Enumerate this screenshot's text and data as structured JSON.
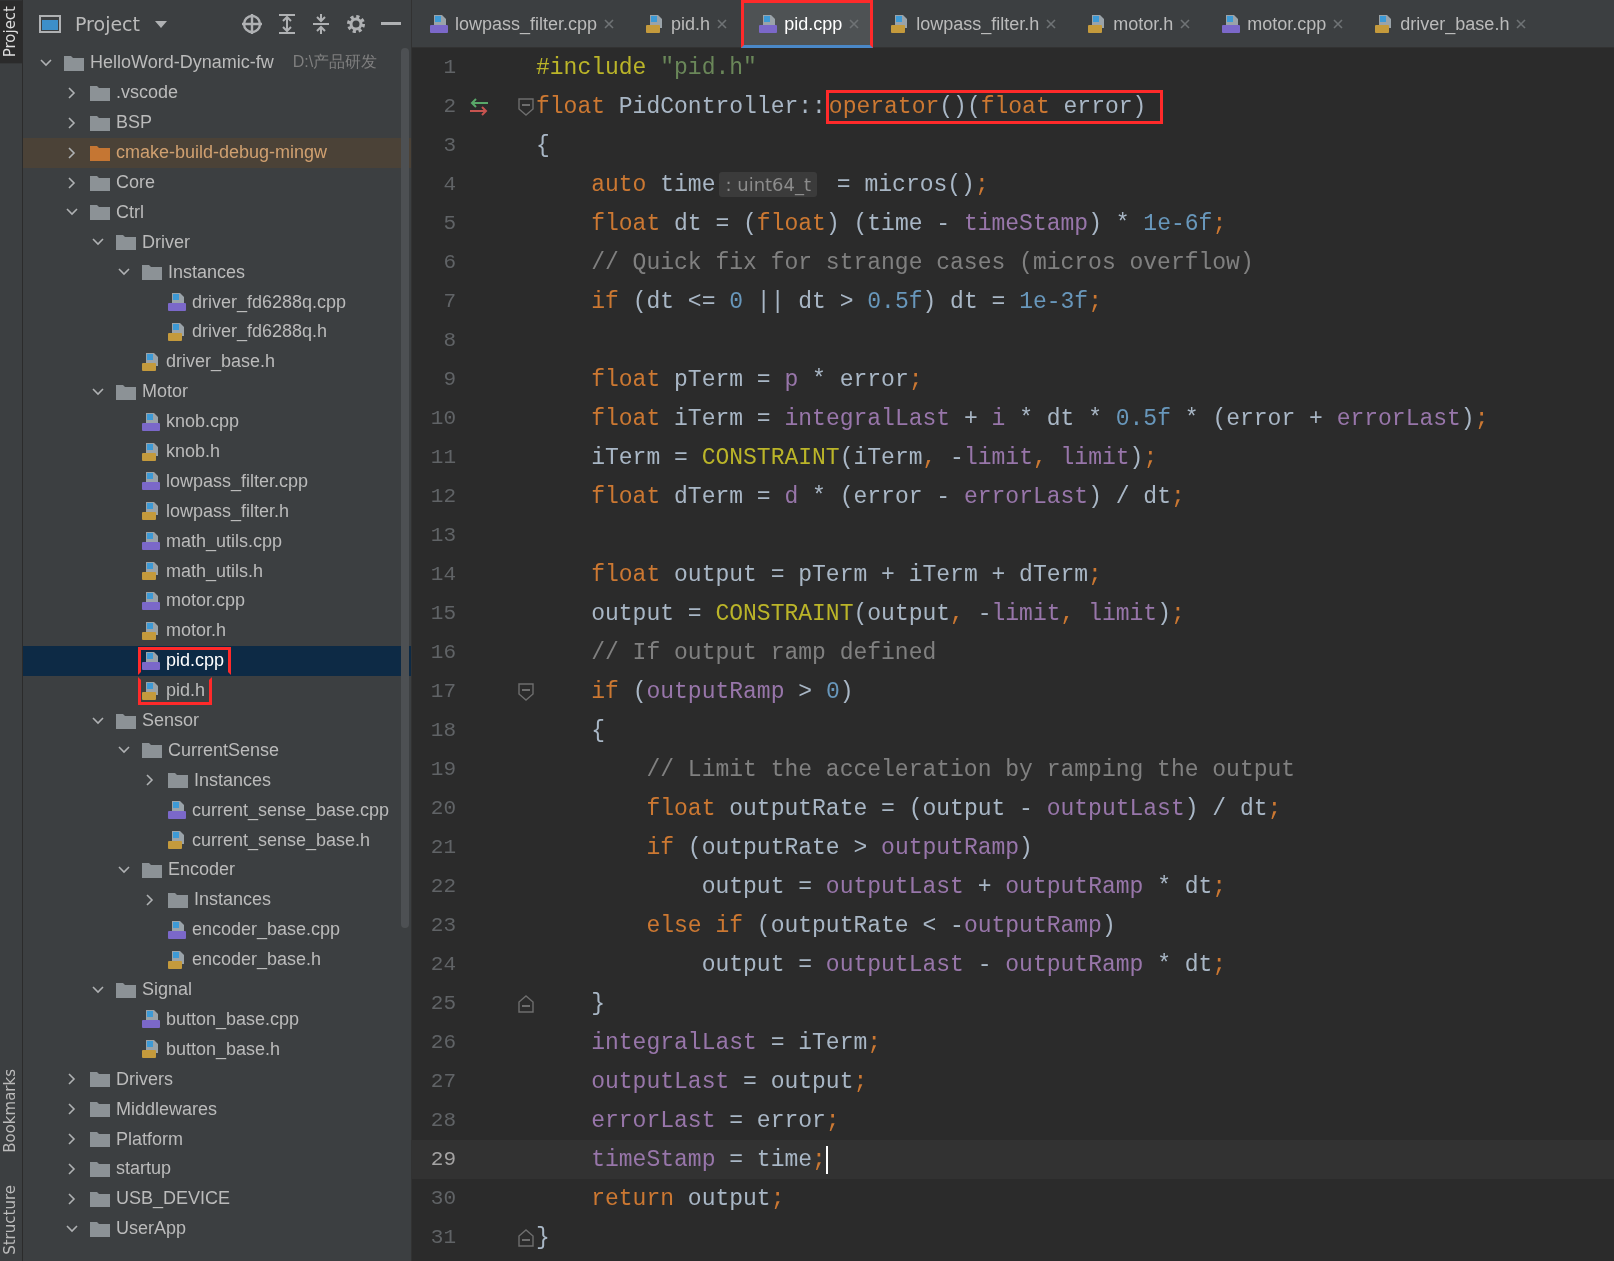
{
  "side_stripe": {
    "top": [
      {
        "label": "Project",
        "selected": true
      }
    ],
    "bottom": [
      {
        "label": "Bookmarks",
        "selected": false
      },
      {
        "label": "Structure",
        "selected": false
      }
    ]
  },
  "project_panel": {
    "title": "Project",
    "tree": [
      {
        "label": "HelloWord-Dynamic-fw",
        "path": "D:\\产品研发",
        "kind": "folder",
        "expanded": true,
        "selected": false,
        "highlighted": false,
        "children": [
          {
            "label": ".vscode",
            "kind": "folder",
            "expanded": false,
            "selected": false,
            "highlighted": false
          },
          {
            "label": "BSP",
            "kind": "folder",
            "expanded": false,
            "selected": false,
            "highlighted": false
          },
          {
            "label": "cmake-build-debug-mingw",
            "kind": "build-folder",
            "expanded": false,
            "selected": false,
            "highlighted": false
          },
          {
            "label": "Core",
            "kind": "folder",
            "expanded": false,
            "selected": false,
            "highlighted": false
          },
          {
            "label": "Ctrl",
            "kind": "folder",
            "expanded": true,
            "selected": false,
            "highlighted": false,
            "children": [
              {
                "label": "Driver",
                "kind": "folder",
                "expanded": true,
                "selected": false,
                "highlighted": false,
                "children": [
                  {
                    "label": "Instances",
                    "kind": "folder",
                    "expanded": true,
                    "selected": false,
                    "highlighted": false,
                    "children": [
                      {
                        "label": "driver_fd6288q.cpp",
                        "kind": "cpp",
                        "selected": false,
                        "highlighted": false
                      },
                      {
                        "label": "driver_fd6288q.h",
                        "kind": "h",
                        "selected": false,
                        "highlighted": false
                      }
                    ]
                  },
                  {
                    "label": "driver_base.h",
                    "kind": "h",
                    "selected": false,
                    "highlighted": false
                  }
                ]
              },
              {
                "label": "Motor",
                "kind": "folder",
                "expanded": true,
                "selected": false,
                "highlighted": false,
                "children": [
                  {
                    "label": "knob.cpp",
                    "kind": "cpp",
                    "selected": false,
                    "highlighted": false
                  },
                  {
                    "label": "knob.h",
                    "kind": "h",
                    "selected": false,
                    "highlighted": false
                  },
                  {
                    "label": "lowpass_filter.cpp",
                    "kind": "cpp",
                    "selected": false,
                    "highlighted": false
                  },
                  {
                    "label": "lowpass_filter.h",
                    "kind": "h",
                    "selected": false,
                    "highlighted": false
                  },
                  {
                    "label": "math_utils.cpp",
                    "kind": "cpp",
                    "selected": false,
                    "highlighted": false
                  },
                  {
                    "label": "math_utils.h",
                    "kind": "h",
                    "selected": false,
                    "highlighted": false
                  },
                  {
                    "label": "motor.cpp",
                    "kind": "cpp",
                    "selected": false,
                    "highlighted": false
                  },
                  {
                    "label": "motor.h",
                    "kind": "h",
                    "selected": false,
                    "highlighted": false
                  },
                  {
                    "label": "pid.cpp",
                    "kind": "cpp",
                    "selected": true,
                    "highlighted": true
                  },
                  {
                    "label": "pid.h",
                    "kind": "h",
                    "selected": false,
                    "highlighted": true
                  }
                ]
              },
              {
                "label": "Sensor",
                "kind": "folder",
                "expanded": true,
                "selected": false,
                "highlighted": false,
                "children": [
                  {
                    "label": "CurrentSense",
                    "kind": "folder",
                    "expanded": true,
                    "selected": false,
                    "highlighted": false,
                    "children": [
                      {
                        "label": "Instances",
                        "kind": "folder",
                        "expanded": false,
                        "selected": false,
                        "highlighted": false
                      },
                      {
                        "label": "current_sense_base.cpp",
                        "kind": "cpp",
                        "selected": false,
                        "highlighted": false
                      },
                      {
                        "label": "current_sense_base.h",
                        "kind": "h",
                        "selected": false,
                        "highlighted": false
                      }
                    ]
                  },
                  {
                    "label": "Encoder",
                    "kind": "folder",
                    "expanded": true,
                    "selected": false,
                    "highlighted": false,
                    "children": [
                      {
                        "label": "Instances",
                        "kind": "folder",
                        "expanded": false,
                        "selected": false,
                        "highlighted": false
                      },
                      {
                        "label": "encoder_base.cpp",
                        "kind": "cpp",
                        "selected": false,
                        "highlighted": false
                      },
                      {
                        "label": "encoder_base.h",
                        "kind": "h",
                        "selected": false,
                        "highlighted": false
                      }
                    ]
                  }
                ]
              },
              {
                "label": "Signal",
                "kind": "folder",
                "expanded": true,
                "selected": false,
                "highlighted": false,
                "children": [
                  {
                    "label": "button_base.cpp",
                    "kind": "cpp",
                    "selected": false,
                    "highlighted": false
                  },
                  {
                    "label": "button_base.h",
                    "kind": "h",
                    "selected": false,
                    "highlighted": false
                  }
                ]
              }
            ]
          },
          {
            "label": "Drivers",
            "kind": "folder",
            "expanded": false,
            "selected": false,
            "highlighted": false
          },
          {
            "label": "Middlewares",
            "kind": "folder",
            "expanded": false,
            "selected": false,
            "highlighted": false
          },
          {
            "label": "Platform",
            "kind": "folder",
            "expanded": false,
            "selected": false,
            "highlighted": false
          },
          {
            "label": "startup",
            "kind": "folder",
            "expanded": false,
            "selected": false,
            "highlighted": false
          },
          {
            "label": "USB_DEVICE",
            "kind": "folder",
            "expanded": false,
            "selected": false,
            "highlighted": false
          },
          {
            "label": "UserApp",
            "kind": "folder",
            "expanded": true,
            "selected": false,
            "highlighted": false
          }
        ]
      }
    ]
  },
  "tabs": [
    {
      "label": "lowpass_filter.cpp",
      "kind": "cpp",
      "selected": false,
      "highlighted": false
    },
    {
      "label": "pid.h",
      "kind": "h",
      "selected": false,
      "highlighted": false
    },
    {
      "label": "pid.cpp",
      "kind": "cpp",
      "selected": true,
      "highlighted": true
    },
    {
      "label": "lowpass_filter.h",
      "kind": "h",
      "selected": false,
      "highlighted": false
    },
    {
      "label": "motor.h",
      "kind": "h",
      "selected": false,
      "highlighted": false
    },
    {
      "label": "motor.cpp",
      "kind": "cpp",
      "selected": false,
      "highlighted": false
    },
    {
      "label": "driver_base.h",
      "kind": "h",
      "selected": false,
      "highlighted": false
    }
  ],
  "editor": {
    "lines": [
      {
        "number": "1",
        "current": false,
        "tokens": [
          {
            "kind": "preproc",
            "text": "#include"
          },
          {
            "kind": "string",
            "text": " \"pid.h\""
          }
        ]
      },
      {
        "number": "2",
        "current": false,
        "override_marker": true,
        "fold_start": true,
        "tokens": [
          {
            "kind": "keyword",
            "text": "float"
          },
          {
            "kind": "plain",
            "text": " PidController::"
          },
          {
            "kind": "keyword",
            "text": "operator",
            "boxed": true
          },
          {
            "kind": "plain",
            "text": "()(",
            "boxed": true
          },
          {
            "kind": "keyword",
            "text": "float",
            "boxed": true
          },
          {
            "kind": "plain",
            "text": " error)",
            "boxed": true
          }
        ]
      },
      {
        "number": "3",
        "current": false,
        "tokens": [
          {
            "kind": "plain",
            "text": "{"
          }
        ]
      },
      {
        "number": "4",
        "current": false,
        "tokens": [
          {
            "kind": "keyword",
            "text": "    auto"
          },
          {
            "kind": "plain",
            "text": " time"
          },
          {
            "kind": "hint",
            "text": ": uint64_t"
          },
          {
            "kind": "plain",
            "text": " = micros()"
          },
          {
            "kind": "keyword",
            "text": ";"
          }
        ]
      },
      {
        "number": "5",
        "current": false,
        "tokens": [
          {
            "kind": "keyword",
            "text": "    float"
          },
          {
            "kind": "plain",
            "text": " dt = ("
          },
          {
            "kind": "keyword",
            "text": "float"
          },
          {
            "kind": "plain",
            "text": ") (time - "
          },
          {
            "kind": "field",
            "text": "timeStamp"
          },
          {
            "kind": "plain",
            "text": ") * "
          },
          {
            "kind": "number",
            "text": "1e-6f"
          },
          {
            "kind": "keyword",
            "text": ";"
          }
        ]
      },
      {
        "number": "6",
        "current": false,
        "tokens": [
          {
            "kind": "comment",
            "text": "    // Quick fix for strange cases (micros overflow)"
          }
        ]
      },
      {
        "number": "7",
        "current": false,
        "tokens": [
          {
            "kind": "keyword",
            "text": "    if"
          },
          {
            "kind": "plain",
            "text": " (dt <= "
          },
          {
            "kind": "number",
            "text": "0"
          },
          {
            "kind": "plain",
            "text": " || dt > "
          },
          {
            "kind": "number",
            "text": "0.5f"
          },
          {
            "kind": "plain",
            "text": ") dt = "
          },
          {
            "kind": "number",
            "text": "1e-3f"
          },
          {
            "kind": "keyword",
            "text": ";"
          }
        ]
      },
      {
        "number": "8",
        "current": false
      },
      {
        "number": "9",
        "current": false,
        "tokens": [
          {
            "kind": "keyword",
            "text": "    float"
          },
          {
            "kind": "plain",
            "text": " pTerm = "
          },
          {
            "kind": "field",
            "text": "p"
          },
          {
            "kind": "plain",
            "text": " * error"
          },
          {
            "kind": "keyword",
            "text": ";"
          }
        ]
      },
      {
        "number": "10",
        "current": false,
        "tokens": [
          {
            "kind": "keyword",
            "text": "    float"
          },
          {
            "kind": "plain",
            "text": " iTerm = "
          },
          {
            "kind": "field",
            "text": "integralLast"
          },
          {
            "kind": "plain",
            "text": " + "
          },
          {
            "kind": "field",
            "text": "i"
          },
          {
            "kind": "plain",
            "text": " * dt * "
          },
          {
            "kind": "number",
            "text": "0.5f"
          },
          {
            "kind": "plain",
            "text": " * (error + "
          },
          {
            "kind": "field",
            "text": "errorLast"
          },
          {
            "kind": "plain",
            "text": ")"
          },
          {
            "kind": "keyword",
            "text": ";"
          }
        ]
      },
      {
        "number": "11",
        "current": false,
        "tokens": [
          {
            "kind": "plain",
            "text": "    iTerm = "
          },
          {
            "kind": "macro",
            "text": "CONSTRAINT"
          },
          {
            "kind": "plain",
            "text": "(iTerm"
          },
          {
            "kind": "keyword",
            "text": ","
          },
          {
            "kind": "plain",
            "text": " -"
          },
          {
            "kind": "field",
            "text": "limit"
          },
          {
            "kind": "keyword",
            "text": ","
          },
          {
            "kind": "field",
            "text": " limit"
          },
          {
            "kind": "plain",
            "text": ")"
          },
          {
            "kind": "keyword",
            "text": ";"
          }
        ]
      },
      {
        "number": "12",
        "current": false,
        "tokens": [
          {
            "kind": "keyword",
            "text": "    float"
          },
          {
            "kind": "plain",
            "text": " dTerm = "
          },
          {
            "kind": "field",
            "text": "d"
          },
          {
            "kind": "plain",
            "text": " * (error - "
          },
          {
            "kind": "field",
            "text": "errorLast"
          },
          {
            "kind": "plain",
            "text": ") / dt"
          },
          {
            "kind": "keyword",
            "text": ";"
          }
        ]
      },
      {
        "number": "13",
        "current": false
      },
      {
        "number": "14",
        "current": false,
        "tokens": [
          {
            "kind": "keyword",
            "text": "    float"
          },
          {
            "kind": "plain",
            "text": " output = pTerm + iTerm + dTerm"
          },
          {
            "kind": "keyword",
            "text": ";"
          }
        ]
      },
      {
        "number": "15",
        "current": false,
        "tokens": [
          {
            "kind": "plain",
            "text": "    output = "
          },
          {
            "kind": "macro",
            "text": "CONSTRAINT"
          },
          {
            "kind": "plain",
            "text": "(output"
          },
          {
            "kind": "keyword",
            "text": ","
          },
          {
            "kind": "plain",
            "text": " -"
          },
          {
            "kind": "field",
            "text": "limit"
          },
          {
            "kind": "keyword",
            "text": ","
          },
          {
            "kind": "field",
            "text": " limit"
          },
          {
            "kind": "plain",
            "text": ")"
          },
          {
            "kind": "keyword",
            "text": ";"
          }
        ]
      },
      {
        "number": "16",
        "current": false,
        "tokens": [
          {
            "kind": "comment",
            "text": "    // If output ramp defined"
          }
        ]
      },
      {
        "number": "17",
        "current": false,
        "fold_start": true,
        "tokens": [
          {
            "kind": "keyword",
            "text": "    if"
          },
          {
            "kind": "plain",
            "text": " ("
          },
          {
            "kind": "field",
            "text": "outputRamp"
          },
          {
            "kind": "plain",
            "text": " > "
          },
          {
            "kind": "number",
            "text": "0"
          },
          {
            "kind": "plain",
            "text": ")"
          }
        ]
      },
      {
        "number": "18",
        "current": false,
        "tokens": [
          {
            "kind": "plain",
            "text": "    {"
          }
        ]
      },
      {
        "number": "19",
        "current": false,
        "tokens": [
          {
            "kind": "comment",
            "text": "        // Limit the acceleration by ramping the output"
          }
        ]
      },
      {
        "number": "20",
        "current": false,
        "tokens": [
          {
            "kind": "keyword",
            "text": "        float"
          },
          {
            "kind": "plain",
            "text": " outputRate = (output - "
          },
          {
            "kind": "field",
            "text": "outputLast"
          },
          {
            "kind": "plain",
            "text": ") / dt"
          },
          {
            "kind": "keyword",
            "text": ";"
          }
        ]
      },
      {
        "number": "21",
        "current": false,
        "tokens": [
          {
            "kind": "keyword",
            "text": "        if"
          },
          {
            "kind": "plain",
            "text": " (outputRate > "
          },
          {
            "kind": "field",
            "text": "outputRamp"
          },
          {
            "kind": "plain",
            "text": ")"
          }
        ]
      },
      {
        "number": "22",
        "current": false,
        "tokens": [
          {
            "kind": "plain",
            "text": "            output = "
          },
          {
            "kind": "field",
            "text": "outputLast"
          },
          {
            "kind": "plain",
            "text": " + "
          },
          {
            "kind": "field",
            "text": "outputRamp"
          },
          {
            "kind": "plain",
            "text": " * dt"
          },
          {
            "kind": "keyword",
            "text": ";"
          }
        ]
      },
      {
        "number": "23",
        "current": false,
        "tokens": [
          {
            "kind": "keyword",
            "text": "        else if"
          },
          {
            "kind": "plain",
            "text": " (outputRate < -"
          },
          {
            "kind": "field",
            "text": "outputRamp"
          },
          {
            "kind": "plain",
            "text": ")"
          }
        ]
      },
      {
        "number": "24",
        "current": false,
        "tokens": [
          {
            "kind": "plain",
            "text": "            output = "
          },
          {
            "kind": "field",
            "text": "outputLast"
          },
          {
            "kind": "plain",
            "text": " - "
          },
          {
            "kind": "field",
            "text": "outputRamp"
          },
          {
            "kind": "plain",
            "text": " * dt"
          },
          {
            "kind": "keyword",
            "text": ";"
          }
        ]
      },
      {
        "number": "25",
        "current": false,
        "fold_end": true,
        "tokens": [
          {
            "kind": "plain",
            "text": "    }"
          }
        ]
      },
      {
        "number": "26",
        "current": false,
        "tokens": [
          {
            "kind": "field",
            "text": "    integralLast"
          },
          {
            "kind": "plain",
            "text": " = iTerm"
          },
          {
            "kind": "keyword",
            "text": ";"
          }
        ]
      },
      {
        "number": "27",
        "current": false,
        "tokens": [
          {
            "kind": "field",
            "text": "    outputLast"
          },
          {
            "kind": "plain",
            "text": " = output"
          },
          {
            "kind": "keyword",
            "text": ";"
          }
        ]
      },
      {
        "number": "28",
        "current": false,
        "tokens": [
          {
            "kind": "field",
            "text": "    errorLast"
          },
          {
            "kind": "plain",
            "text": " = error"
          },
          {
            "kind": "keyword",
            "text": ";"
          }
        ]
      },
      {
        "number": "29",
        "current": true,
        "tokens": [
          {
            "kind": "field",
            "text": "    timeStamp"
          },
          {
            "kind": "plain",
            "text": " = time"
          },
          {
            "kind": "keyword",
            "text": ";"
          }
        ]
      },
      {
        "number": "30",
        "current": false,
        "tokens": [
          {
            "kind": "keyword",
            "text": "    return"
          },
          {
            "kind": "plain",
            "text": " output"
          },
          {
            "kind": "keyword",
            "text": ";"
          }
        ]
      },
      {
        "number": "31",
        "current": false,
        "fold_end": true,
        "tokens": [
          {
            "kind": "plain",
            "text": "}"
          }
        ]
      }
    ]
  }
}
